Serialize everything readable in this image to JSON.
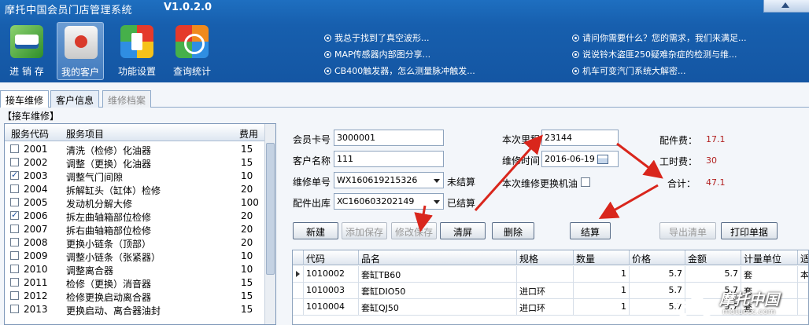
{
  "app": {
    "title": "摩托中国会员门店管理系统",
    "version": "V1.0.2.0"
  },
  "toolbar": {
    "stock_label": "进 销 存",
    "clients_label": "我的客户",
    "settings_label": "功能设置",
    "query_label": "查询统计"
  },
  "news": [
    "我总于找到了真空波形...",
    "请问你需要什么？您的需求，我们来满足...",
    "MAP传感器内部图分享...",
    "说说铃木盗匪250疑难杂症的检测与维...",
    "CB400触发器，怎么测量脉冲触发...",
    "机车可变汽门系统大解密..."
  ],
  "tabs": [
    "接车维修",
    "客户信息",
    "维修档案"
  ],
  "panel_title": "【接车维修】",
  "service_table": {
    "headers": {
      "code": "服务代码",
      "item": "服务项目",
      "fee": "费用"
    },
    "rows": [
      {
        "code": "2001",
        "item": "清洗（检修）化油器",
        "fee": "15",
        "checked": false
      },
      {
        "code": "2002",
        "item": "调整（更换）化油器",
        "fee": "15",
        "checked": false
      },
      {
        "code": "2003",
        "item": "调整气门间隙",
        "fee": "10",
        "checked": true
      },
      {
        "code": "2004",
        "item": "拆解缸头（缸体）检修",
        "fee": "20",
        "checked": false
      },
      {
        "code": "2005",
        "item": "发动机分解大修",
        "fee": "100",
        "checked": false
      },
      {
        "code": "2006",
        "item": "拆左曲轴箱部位检修",
        "fee": "20",
        "checked": true
      },
      {
        "code": "2007",
        "item": "拆右曲轴箱部位检修",
        "fee": "20",
        "checked": false
      },
      {
        "code": "2008",
        "item": "更换小链条（顶部）",
        "fee": "20",
        "checked": false
      },
      {
        "code": "2009",
        "item": "调整小链条（张紧器）",
        "fee": "10",
        "checked": false
      },
      {
        "code": "2010",
        "item": "调整离合器",
        "fee": "10",
        "checked": false
      },
      {
        "code": "2011",
        "item": "检修（更换）消音器",
        "fee": "15",
        "checked": false
      },
      {
        "code": "2012",
        "item": "检修更换启动离合器",
        "fee": "15",
        "checked": false
      },
      {
        "code": "2013",
        "item": "更换启动、离合器油封",
        "fee": "15",
        "checked": false
      }
    ]
  },
  "form": {
    "card_label": "会员卡号",
    "card_value": "3000001",
    "name_label": "客户名称",
    "name_value": "111",
    "order_label": "维修单号",
    "order_value": "WX160619215326",
    "order_status": "未结算",
    "parts_label": "配件出库",
    "parts_value": "XC160603202149",
    "parts_status": "已结算",
    "mileage_label": "本次里程",
    "mileage_value": "23144",
    "time_label": "维修时间",
    "time_value": "2016-06-19",
    "oil_label": "本次维修更换机油",
    "parts_fee_label": "配件费：",
    "parts_fee_value": "17.1",
    "labor_fee_label": "工时费：",
    "labor_fee_value": "30",
    "total_label": "合计：",
    "total_value": "47.1"
  },
  "buttons": {
    "new": "新建",
    "add_save": "添加保存",
    "edit_save": "修改保存",
    "clear": "清屏",
    "delete": "删除",
    "settle": "结算",
    "export": "导出清单",
    "print": "打印单据"
  },
  "grid": {
    "headers": [
      "代码",
      "品名",
      "规格",
      "数量",
      "价格",
      "金额",
      "计量单位",
      "适"
    ],
    "rows": [
      {
        "code": "1010002",
        "name": "套缸TB60",
        "spec": "",
        "qty": "1",
        "price": "5.7",
        "amount": "5.7",
        "unit": "套",
        "extra": "本"
      },
      {
        "code": "1010003",
        "name": "套缸DIO50",
        "spec": "进口环",
        "qty": "1",
        "price": "5.7",
        "amount": "5.7",
        "unit": "套",
        "extra": ""
      },
      {
        "code": "1010004",
        "name": "套缸QJ50",
        "spec": "进口环",
        "qty": "1",
        "price": "5.7",
        "amount": "5.7",
        "unit": "套",
        "extra": ""
      }
    ]
  },
  "watermark": {
    "text": "摩托中国",
    "sub": "motuosc.com"
  },
  "colors": {
    "header_blue": "#1a64b4",
    "money_red": "#b22222",
    "arrow_red": "#d9261c"
  }
}
